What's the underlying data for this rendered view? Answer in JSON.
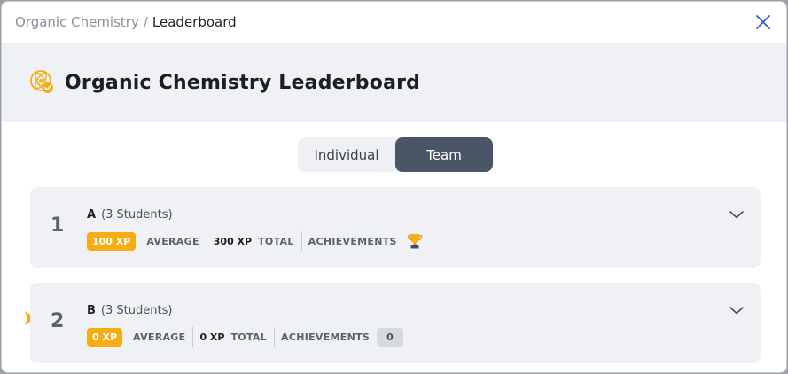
{
  "breadcrumb": {
    "parent": "Organic Chemistry",
    "separator": "/",
    "current": "Leaderboard"
  },
  "header": {
    "title": "Organic Chemistry Leaderboard",
    "icon": "atom-badge-icon"
  },
  "toggle": {
    "individual_label": "Individual",
    "team_label": "Team",
    "selected": "Team"
  },
  "teams": [
    {
      "rank": "1",
      "name": "A",
      "students": "(3 Students)",
      "average_xp": "100 XP",
      "average_label": "AVERAGE",
      "total_xp": "300 XP",
      "total_label": "TOTAL",
      "achievements_label": "ACHIEVEMENTS",
      "achievement_icon": "trophy-icon"
    },
    {
      "rank": "2",
      "name": "B",
      "students": "(3 Students)",
      "average_xp": "0 XP",
      "average_label": "AVERAGE",
      "total_xp": "0 XP",
      "total_label": "TOTAL",
      "achievements_label": "ACHIEVEMENTS",
      "achievements_count": "0"
    }
  ],
  "colors": {
    "accent": "#f6ad15",
    "toggle_active": "#4a5568",
    "close": "#3b5ccc"
  }
}
